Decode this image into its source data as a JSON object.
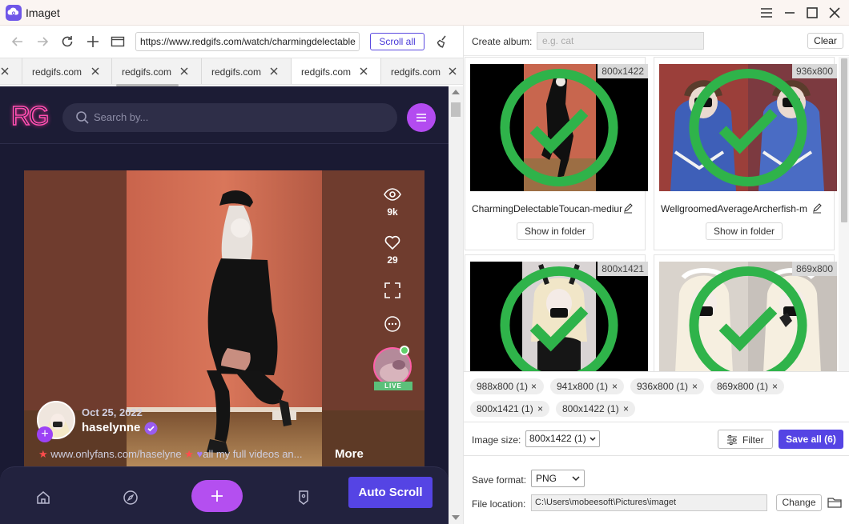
{
  "app": {
    "title": "Imaget"
  },
  "browser": {
    "url": "https://www.redgifs.com/watch/charmingdelectable",
    "scroll_all_label": "Scroll all",
    "tabs": [
      {
        "label": ""
      },
      {
        "label": "redgifs.com"
      },
      {
        "label": "redgifs.com"
      },
      {
        "label": "redgifs.com"
      },
      {
        "label": "redgifs.com",
        "active": true
      },
      {
        "label": "redgifs.com"
      }
    ]
  },
  "site": {
    "logo": "RG",
    "search_placeholder": "Search by...",
    "post": {
      "views": "9k",
      "likes": "29",
      "date": "Oct 25, 2022",
      "creator": "haselynne",
      "caption": "www.onlyfans.com/haselyne",
      "caption_rest": "all my full videos an...",
      "more_label": "More",
      "live_label": "LIVE"
    },
    "auto_scroll_label": "Auto Scroll",
    "nav_icons": [
      "home-icon",
      "compass-icon",
      "plus-icon",
      "tag-icon"
    ]
  },
  "panel": {
    "create_album_label": "Create album:",
    "album_placeholder": "e.g. cat",
    "clear_label": "Clear",
    "images": [
      {
        "size": "800x1422",
        "name": "CharmingDelectableToucan-mediur",
        "folder_label": "Show in folder",
        "checked": true
      },
      {
        "size": "936x800",
        "name": "WellgroomedAverageArcherfish-m",
        "folder_label": "Show in folder",
        "checked": true
      },
      {
        "size": "800x1421",
        "name": "",
        "folder_label": "",
        "checked": true
      },
      {
        "size": "869x800",
        "name": "",
        "folder_label": "",
        "checked": true
      }
    ],
    "size_chips": [
      {
        "label": "988x800 (1)"
      },
      {
        "label": "941x800 (1)"
      },
      {
        "label": "936x800 (1)"
      },
      {
        "label": "869x800 (1)"
      },
      {
        "label": "800x1421 (1)"
      },
      {
        "label": "800x1422 (1)"
      }
    ],
    "chip_remove_glyph": "×",
    "image_size_label": "Image size:",
    "image_size_value": "800x1422 (1)",
    "filter_label": "Filter",
    "save_all_label": "Save all (6)",
    "save_format_label": "Save format:",
    "save_format_value": "PNG",
    "file_location_label": "File location:",
    "file_location_value": "C:\\Users\\mobeesoft\\Pictures\\imaget",
    "change_label": "Change"
  },
  "colors": {
    "accent": "#5544e4",
    "site_bg": "#1a1a33",
    "site_purple": "#b44ff0",
    "check_green": "#2fb34a"
  }
}
